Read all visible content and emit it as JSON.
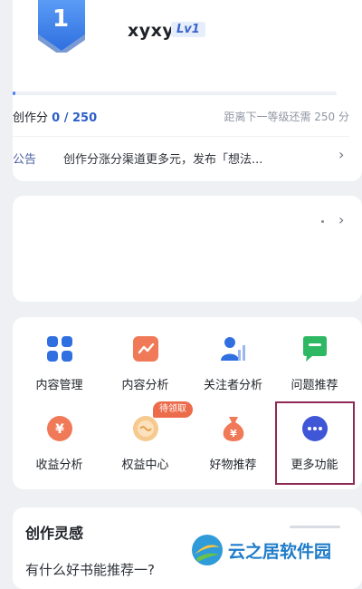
{
  "profile": {
    "level_number": "1",
    "username": "xyxy",
    "level_tag": "Lv1",
    "progress_fraction": 0.0,
    "score_label": "创作分",
    "score_value": "0 / 250",
    "next_level_text": "距离下一等级还需 250 分"
  },
  "notice": {
    "tag": "公告",
    "text": "创作分涨分渠道更多元，发布「想法...",
    "chevron": "›"
  },
  "blank_card": {
    "chevron": "›"
  },
  "tools": [
    {
      "label": "内容管理",
      "icon": "grid-icon"
    },
    {
      "label": "内容分析",
      "icon": "chart-icon"
    },
    {
      "label": "关注者分析",
      "icon": "followers-icon"
    },
    {
      "label": "问题推荐",
      "icon": "question-icon"
    },
    {
      "label": "收益分析",
      "icon": "yen-icon"
    },
    {
      "label": "权益中心",
      "icon": "benefits-icon"
    },
    {
      "label": "好物推荐",
      "icon": "money-bag-icon"
    },
    {
      "label": "更多功能",
      "icon": "more-icon"
    }
  ],
  "badge_text": "待领取",
  "inspiration": {
    "title": "创作灵感",
    "article": "有什么好书能推荐一?"
  },
  "watermark": {
    "text": "云之居软件园"
  },
  "colors": {
    "accent": "#2d5ec8",
    "highlight_border": "#8e2a55",
    "badge": "#ec6b4a"
  }
}
